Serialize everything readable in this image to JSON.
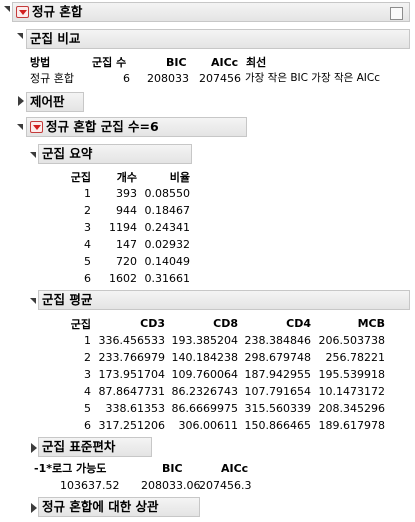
{
  "report": {
    "title": "정규 혼합",
    "compare": {
      "title": "군집 비교",
      "headers": [
        "방법",
        "군집 수",
        "BIC",
        "AICc",
        "최선"
      ],
      "row": [
        "정규 혼합",
        "6",
        "208033",
        "207456",
        "가장 작은 BIC 가장 작은 AICc"
      ]
    },
    "control_panel": {
      "title": "제어판"
    },
    "mixture": {
      "title": "정규 혼합 군집 수=6",
      "summary": {
        "title": "군집 요약",
        "headers": [
          "군집",
          "개수",
          "비율"
        ],
        "rows": [
          [
            "1",
            "393",
            "0.08550"
          ],
          [
            "2",
            "944",
            "0.18467"
          ],
          [
            "3",
            "1194",
            "0.24341"
          ],
          [
            "4",
            "147",
            "0.02932"
          ],
          [
            "5",
            "720",
            "0.14049"
          ],
          [
            "6",
            "1602",
            "0.31661"
          ]
        ]
      },
      "means": {
        "title": "군집 평균",
        "headers": [
          "군집",
          "CD3",
          "CD8",
          "CD4",
          "MCB"
        ],
        "rows": [
          [
            "1",
            "336.456533",
            "193.385204",
            "238.384846",
            "206.503738"
          ],
          [
            "2",
            "233.766979",
            "140.184238",
            "298.679748",
            "256.78221"
          ],
          [
            "3",
            "173.951704",
            "109.760064",
            "187.942955",
            "195.539918"
          ],
          [
            "4",
            "87.8647731",
            "86.2326743",
            "107.791654",
            "10.1473172"
          ],
          [
            "5",
            "338.61353",
            "86.6669975",
            "315.560339",
            "208.345296"
          ],
          [
            "6",
            "317.251206",
            "306.00611",
            "150.866465",
            "189.617978"
          ]
        ]
      },
      "stddev": {
        "title": "군집 표준편차",
        "headers": [
          "-1*로그 가능도",
          "BIC",
          "AICc"
        ],
        "values": [
          "103637.52",
          "208033.06",
          "207456.3"
        ]
      },
      "correlation": {
        "title": "정규 혼합에 대한 상관"
      }
    }
  }
}
